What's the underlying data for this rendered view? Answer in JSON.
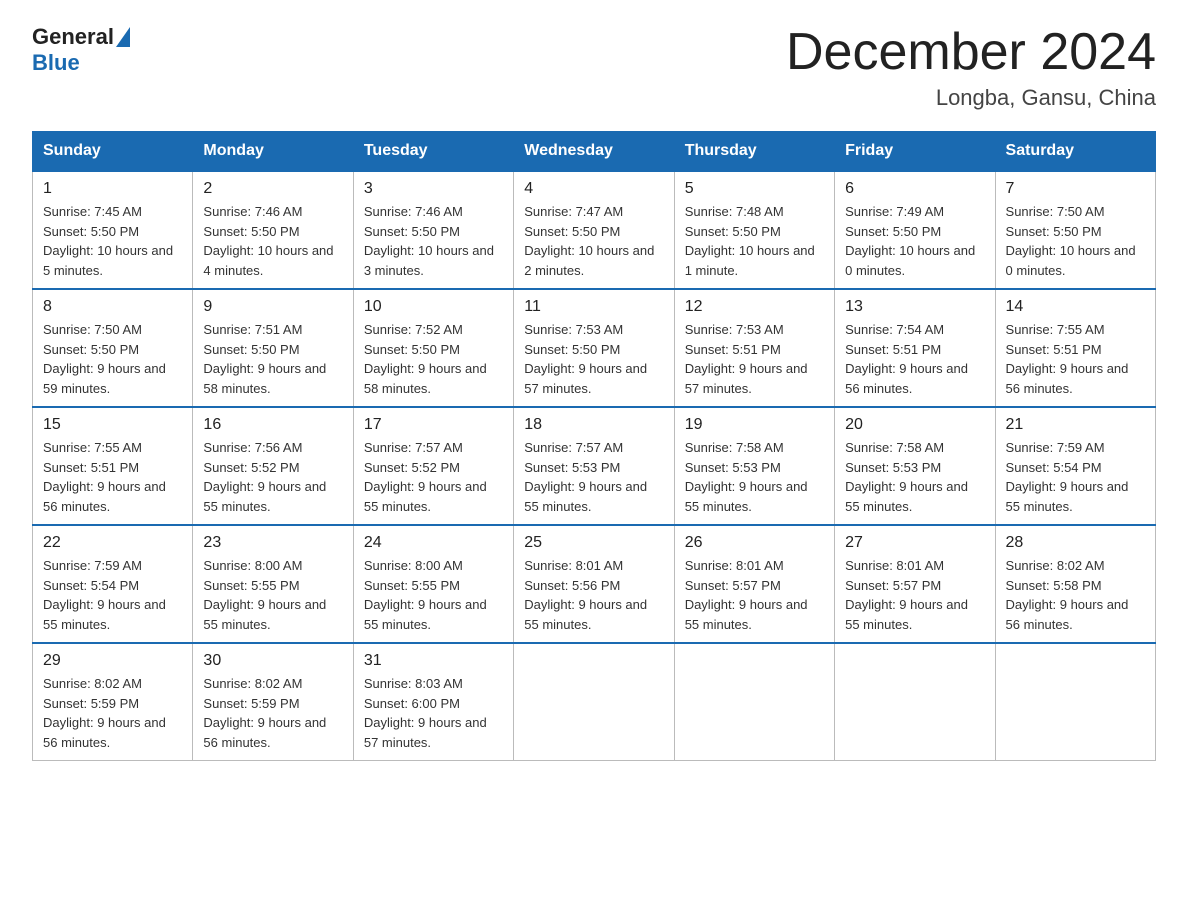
{
  "logo": {
    "general": "General",
    "blue": "Blue"
  },
  "title": "December 2024",
  "location": "Longba, Gansu, China",
  "days_of_week": [
    "Sunday",
    "Monday",
    "Tuesday",
    "Wednesday",
    "Thursday",
    "Friday",
    "Saturday"
  ],
  "weeks": [
    [
      {
        "day": "1",
        "sunrise": "7:45 AM",
        "sunset": "5:50 PM",
        "daylight": "10 hours and 5 minutes."
      },
      {
        "day": "2",
        "sunrise": "7:46 AM",
        "sunset": "5:50 PM",
        "daylight": "10 hours and 4 minutes."
      },
      {
        "day": "3",
        "sunrise": "7:46 AM",
        "sunset": "5:50 PM",
        "daylight": "10 hours and 3 minutes."
      },
      {
        "day": "4",
        "sunrise": "7:47 AM",
        "sunset": "5:50 PM",
        "daylight": "10 hours and 2 minutes."
      },
      {
        "day": "5",
        "sunrise": "7:48 AM",
        "sunset": "5:50 PM",
        "daylight": "10 hours and 1 minute."
      },
      {
        "day": "6",
        "sunrise": "7:49 AM",
        "sunset": "5:50 PM",
        "daylight": "10 hours and 0 minutes."
      },
      {
        "day": "7",
        "sunrise": "7:50 AM",
        "sunset": "5:50 PM",
        "daylight": "10 hours and 0 minutes."
      }
    ],
    [
      {
        "day": "8",
        "sunrise": "7:50 AM",
        "sunset": "5:50 PM",
        "daylight": "9 hours and 59 minutes."
      },
      {
        "day": "9",
        "sunrise": "7:51 AM",
        "sunset": "5:50 PM",
        "daylight": "9 hours and 58 minutes."
      },
      {
        "day": "10",
        "sunrise": "7:52 AM",
        "sunset": "5:50 PM",
        "daylight": "9 hours and 58 minutes."
      },
      {
        "day": "11",
        "sunrise": "7:53 AM",
        "sunset": "5:50 PM",
        "daylight": "9 hours and 57 minutes."
      },
      {
        "day": "12",
        "sunrise": "7:53 AM",
        "sunset": "5:51 PM",
        "daylight": "9 hours and 57 minutes."
      },
      {
        "day": "13",
        "sunrise": "7:54 AM",
        "sunset": "5:51 PM",
        "daylight": "9 hours and 56 minutes."
      },
      {
        "day": "14",
        "sunrise": "7:55 AM",
        "sunset": "5:51 PM",
        "daylight": "9 hours and 56 minutes."
      }
    ],
    [
      {
        "day": "15",
        "sunrise": "7:55 AM",
        "sunset": "5:51 PM",
        "daylight": "9 hours and 56 minutes."
      },
      {
        "day": "16",
        "sunrise": "7:56 AM",
        "sunset": "5:52 PM",
        "daylight": "9 hours and 55 minutes."
      },
      {
        "day": "17",
        "sunrise": "7:57 AM",
        "sunset": "5:52 PM",
        "daylight": "9 hours and 55 minutes."
      },
      {
        "day": "18",
        "sunrise": "7:57 AM",
        "sunset": "5:53 PM",
        "daylight": "9 hours and 55 minutes."
      },
      {
        "day": "19",
        "sunrise": "7:58 AM",
        "sunset": "5:53 PM",
        "daylight": "9 hours and 55 minutes."
      },
      {
        "day": "20",
        "sunrise": "7:58 AM",
        "sunset": "5:53 PM",
        "daylight": "9 hours and 55 minutes."
      },
      {
        "day": "21",
        "sunrise": "7:59 AM",
        "sunset": "5:54 PM",
        "daylight": "9 hours and 55 minutes."
      }
    ],
    [
      {
        "day": "22",
        "sunrise": "7:59 AM",
        "sunset": "5:54 PM",
        "daylight": "9 hours and 55 minutes."
      },
      {
        "day": "23",
        "sunrise": "8:00 AM",
        "sunset": "5:55 PM",
        "daylight": "9 hours and 55 minutes."
      },
      {
        "day": "24",
        "sunrise": "8:00 AM",
        "sunset": "5:55 PM",
        "daylight": "9 hours and 55 minutes."
      },
      {
        "day": "25",
        "sunrise": "8:01 AM",
        "sunset": "5:56 PM",
        "daylight": "9 hours and 55 minutes."
      },
      {
        "day": "26",
        "sunrise": "8:01 AM",
        "sunset": "5:57 PM",
        "daylight": "9 hours and 55 minutes."
      },
      {
        "day": "27",
        "sunrise": "8:01 AM",
        "sunset": "5:57 PM",
        "daylight": "9 hours and 55 minutes."
      },
      {
        "day": "28",
        "sunrise": "8:02 AM",
        "sunset": "5:58 PM",
        "daylight": "9 hours and 56 minutes."
      }
    ],
    [
      {
        "day": "29",
        "sunrise": "8:02 AM",
        "sunset": "5:59 PM",
        "daylight": "9 hours and 56 minutes."
      },
      {
        "day": "30",
        "sunrise": "8:02 AM",
        "sunset": "5:59 PM",
        "daylight": "9 hours and 56 minutes."
      },
      {
        "day": "31",
        "sunrise": "8:03 AM",
        "sunset": "6:00 PM",
        "daylight": "9 hours and 57 minutes."
      },
      null,
      null,
      null,
      null
    ]
  ]
}
